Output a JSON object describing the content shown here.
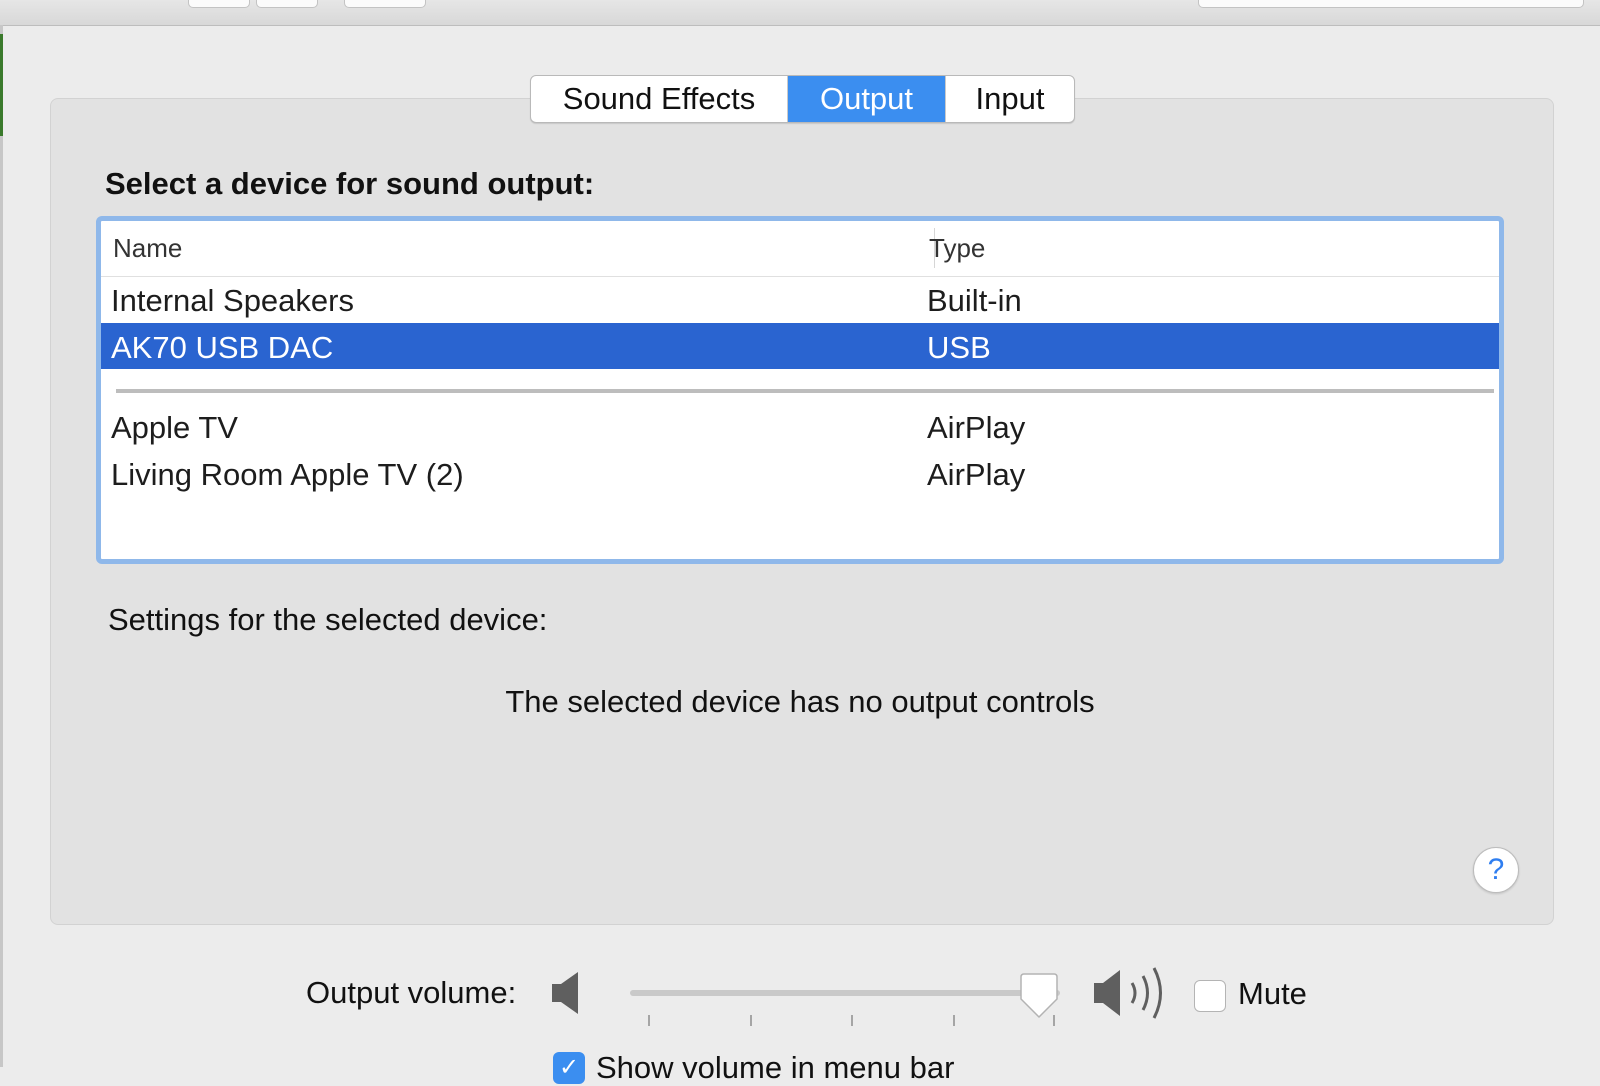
{
  "tabs": [
    {
      "label": "Sound Effects",
      "selected": false
    },
    {
      "label": "Output",
      "selected": true
    },
    {
      "label": "Input",
      "selected": false
    }
  ],
  "heading": "Select a device for sound output:",
  "table": {
    "columns": [
      "Name",
      "Type"
    ],
    "rows": [
      {
        "name": "Internal Speakers",
        "type": "Built-in",
        "selected": false
      },
      {
        "name": "AK70 USB DAC",
        "type": "USB",
        "selected": true
      },
      {
        "name": "Apple TV",
        "type": "AirPlay",
        "selected": false
      },
      {
        "name": "Living Room Apple TV (2)",
        "type": "AirPlay",
        "selected": false
      }
    ]
  },
  "settings_label": "Settings for the selected device:",
  "no_controls_message": "The selected device has no output controls",
  "help_label": "?",
  "volume": {
    "label": "Output volume:",
    "level": 0.95,
    "mute_label": "Mute",
    "mute_checked": false
  },
  "show_in_menu_bar": {
    "label": "Show volume in menu bar",
    "checked": true
  },
  "colors": {
    "accent": "#3b8ef0",
    "selection": "#2a64d0",
    "focus_ring": "#8fb8ea"
  },
  "icons": {
    "volume_low": "speaker-low-icon",
    "volume_high": "speaker-high-icon",
    "help": "question-icon",
    "check": "checkmark-icon"
  }
}
